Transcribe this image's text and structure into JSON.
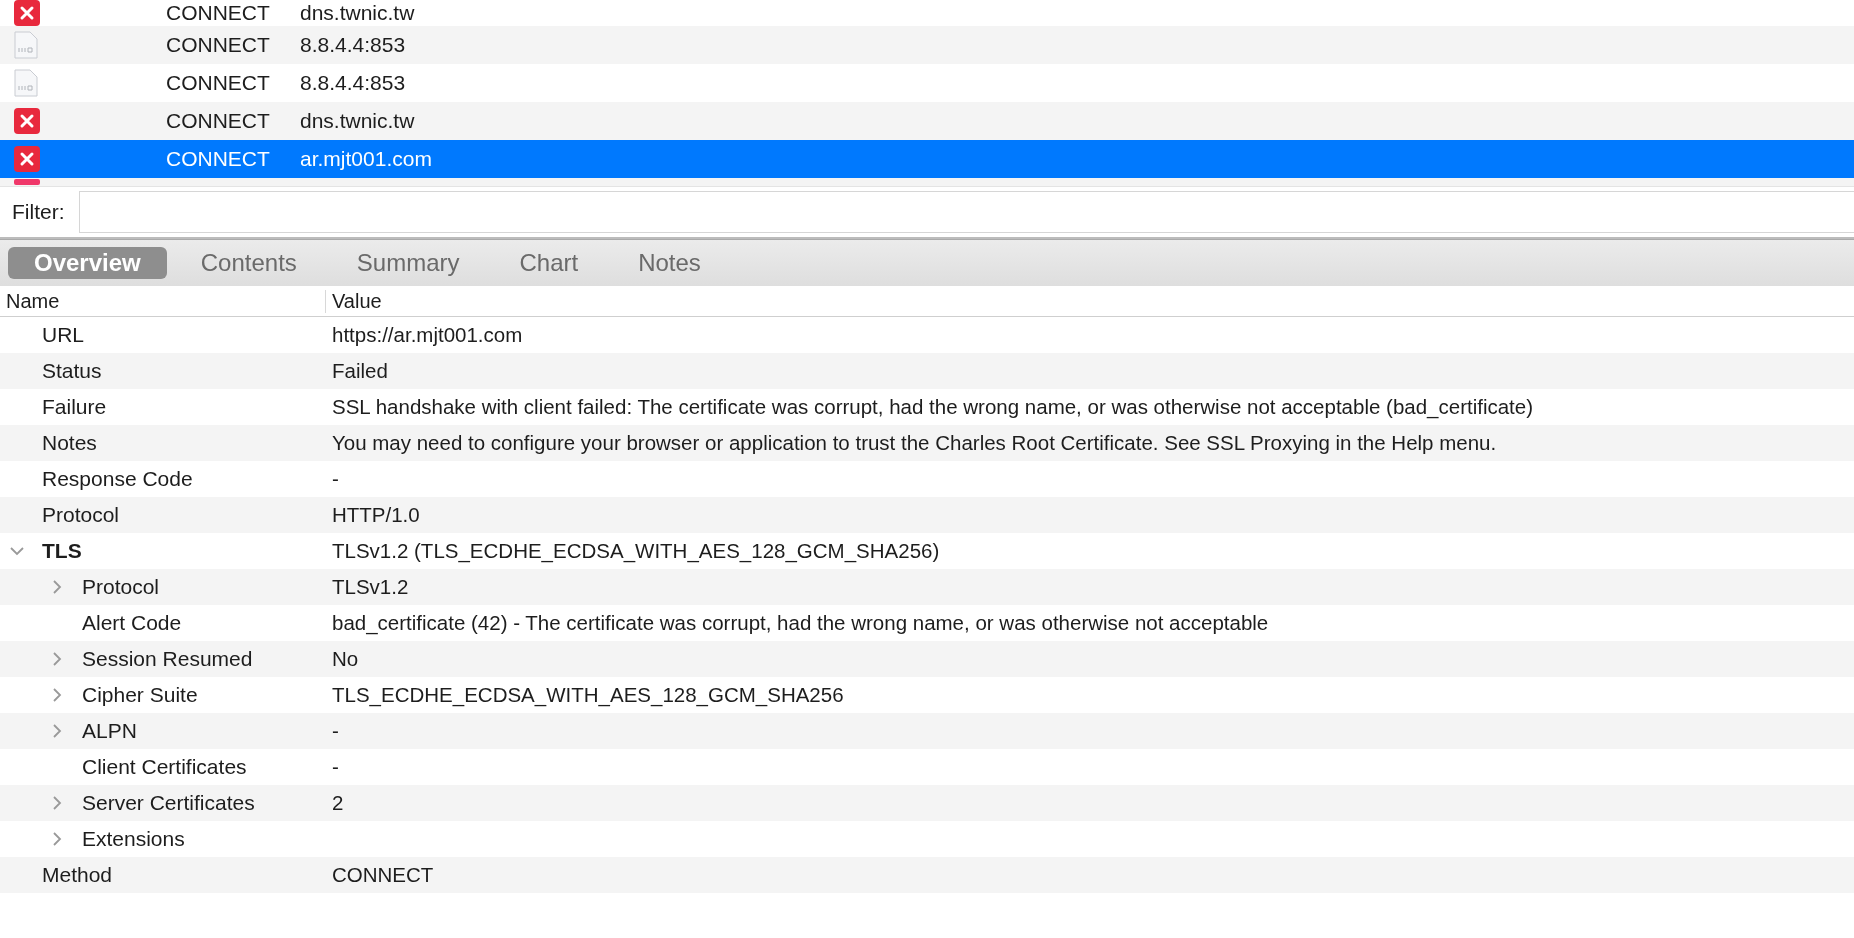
{
  "sessions": [
    {
      "kind": "error",
      "method": "CONNECT",
      "host": "dns.twnic.tw",
      "selected": false
    },
    {
      "kind": "file",
      "method": "CONNECT",
      "host": "8.8.4.4:853",
      "selected": false
    },
    {
      "kind": "file",
      "method": "CONNECT",
      "host": "8.8.4.4:853",
      "selected": false
    },
    {
      "kind": "error",
      "method": "CONNECT",
      "host": "dns.twnic.tw",
      "selected": false
    },
    {
      "kind": "error",
      "method": "CONNECT",
      "host": "ar.mjt001.com",
      "selected": true
    },
    {
      "kind": "stub",
      "selected": false
    }
  ],
  "filter": {
    "label": "Filter:"
  },
  "tabs": [
    {
      "label": "Overview",
      "selected": true
    },
    {
      "label": "Contents",
      "selected": false
    },
    {
      "label": "Summary",
      "selected": false
    },
    {
      "label": "Chart",
      "selected": false
    },
    {
      "label": "Notes",
      "selected": false
    }
  ],
  "columns": [
    "Name",
    "Value"
  ],
  "rows": [
    {
      "kind": "leaf",
      "name": "URL",
      "value": "https://ar.mjt001.com"
    },
    {
      "kind": "leaf",
      "name": "Status",
      "value": "Failed"
    },
    {
      "kind": "leaf",
      "name": "Failure",
      "value": "SSL handshake with client failed: The certificate was corrupt, had the wrong name, or was otherwise not acceptable (bad_certificate)"
    },
    {
      "kind": "leaf",
      "name": "Notes",
      "value": "You may need to configure your browser or application to trust the Charles Root Certificate. See SSL Proxying in the Help menu."
    },
    {
      "kind": "leaf",
      "name": "Response Code",
      "value": "-"
    },
    {
      "kind": "leaf",
      "name": "Protocol",
      "value": "HTTP/1.0"
    },
    {
      "kind": "group",
      "name": "TLS",
      "value": "TLSv1.2 (TLS_ECDHE_ECDSA_WITH_AES_128_GCM_SHA256)",
      "expanded": true,
      "children": [
        {
          "kind": "group",
          "name": "Protocol",
          "value": "TLSv1.2",
          "expanded": false
        },
        {
          "kind": "leaf",
          "name": "Alert Code",
          "value": "bad_certificate (42) - The certificate was corrupt, had the wrong name, or was otherwise not acceptable"
        },
        {
          "kind": "group",
          "name": "Session Resumed",
          "value": "No",
          "expanded": false
        },
        {
          "kind": "group",
          "name": "Cipher Suite",
          "value": "TLS_ECDHE_ECDSA_WITH_AES_128_GCM_SHA256",
          "expanded": false
        },
        {
          "kind": "group",
          "name": "ALPN",
          "value": "-",
          "expanded": false
        },
        {
          "kind": "leaf",
          "name": "Client Certificates",
          "value": "-"
        },
        {
          "kind": "group",
          "name": "Server Certificates",
          "value": "2",
          "expanded": false
        },
        {
          "kind": "group",
          "name": "Extensions",
          "expanded": false
        }
      ]
    },
    {
      "kind": "leaf",
      "name": "Method",
      "value": "CONNECT"
    }
  ]
}
